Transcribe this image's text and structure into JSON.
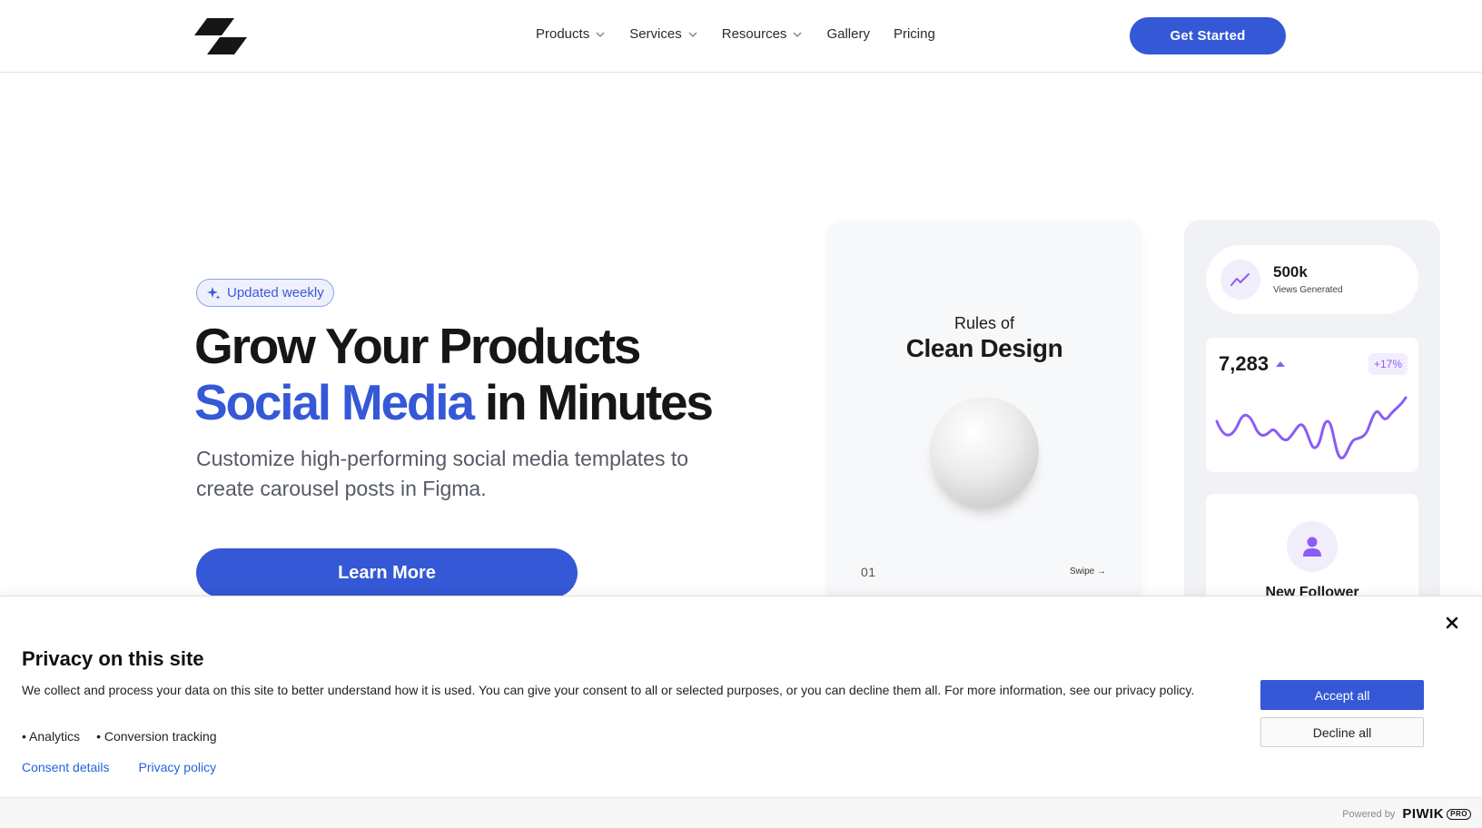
{
  "header": {
    "nav": [
      {
        "label": "Products",
        "has_dropdown": true
      },
      {
        "label": "Services",
        "has_dropdown": true
      },
      {
        "label": "Resources",
        "has_dropdown": true
      },
      {
        "label": "Gallery",
        "has_dropdown": false
      },
      {
        "label": "Pricing",
        "has_dropdown": false
      }
    ],
    "cta_label": "Get Started"
  },
  "hero": {
    "badge": "Updated weekly",
    "title_line1": "Grow Your Products",
    "title_accent": "Social Media",
    "title_rest": " in Minutes",
    "subtitle": "Customize high-performing social media templates to create carousel posts in Figma.",
    "button_label": "Learn More"
  },
  "design_card": {
    "small_title": "Rules of",
    "big_title": "Clean Design",
    "page_number": "01",
    "swipe_label": "Swipe →"
  },
  "stats": {
    "views_value": "500k",
    "views_label": "Views Generated",
    "graph_value": "7,283",
    "graph_change": "+17%",
    "follower_label": "New Follower"
  },
  "consent": {
    "title": "Privacy on this site",
    "text": "We collect and process your data on this site to better understand how it is used. You can give your consent to all or selected purposes, or you can decline them all. For more information, see our privacy policy.",
    "purposes": [
      "Analytics",
      "Conversion tracking"
    ],
    "links": [
      "Consent details",
      "Privacy policy"
    ],
    "accept_label": "Accept all",
    "decline_label": "Decline all",
    "powered_by": "Powered by",
    "brand": "PIWIK",
    "brand_suffix": "PRO"
  },
  "colors": {
    "brand_blue": "#3558d6",
    "accent_purple": "#8b5cf6"
  },
  "icons": {
    "logo": "stripes-logo-icon",
    "badge": "sparkle-icon",
    "views": "trend-up-icon",
    "follower": "user-icon",
    "close": "close-icon"
  }
}
